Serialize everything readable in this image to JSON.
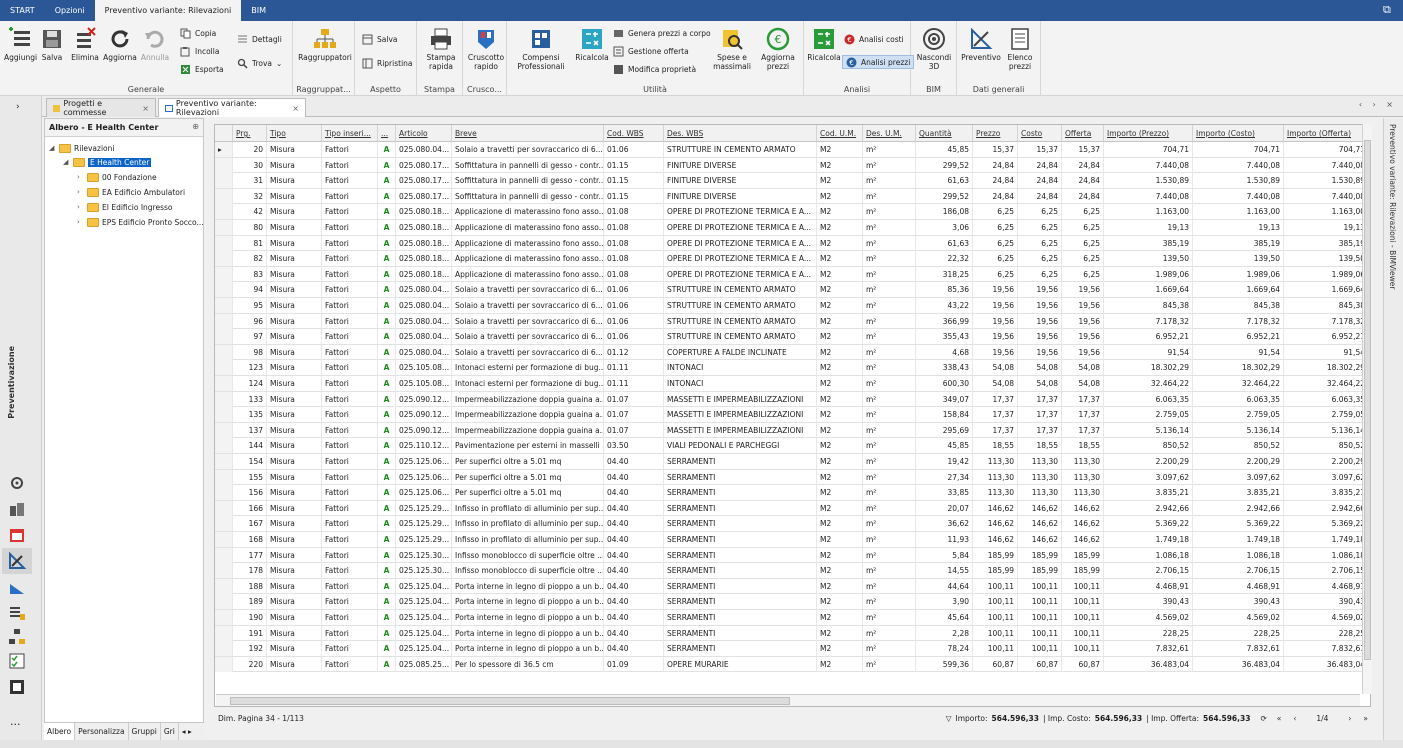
{
  "menu": {
    "tabs": [
      "START",
      "Opzioni",
      "Preventivo variante: Rilevazioni",
      "BIM"
    ],
    "active": 2
  },
  "ribbon": {
    "groups": [
      {
        "caption": "Generale",
        "buttons": [
          "Aggiungi",
          "Salva",
          "Elimina",
          "Aggiorna",
          "Annulla"
        ],
        "small": [
          "Copia",
          "Incolla",
          "Esporta",
          "Dettagli",
          "Trova"
        ]
      },
      {
        "caption": "Raggruppat...",
        "buttons": [
          "Raggruppatori"
        ]
      },
      {
        "caption": "Aspetto",
        "small": [
          "Salva",
          "Ripristina"
        ]
      },
      {
        "caption": "Stampa",
        "buttons": [
          "Stampa rapida"
        ]
      },
      {
        "caption": "Crusco...",
        "buttons": [
          "Cruscotto rapido"
        ]
      },
      {
        "caption": "Utilità",
        "buttons": [
          "Compensi Professionali",
          "Ricalcola"
        ],
        "small": [
          "Genera prezzi a corpo",
          "Gestione offerta",
          "Modifica proprietà"
        ],
        "buttons2": [
          "Spese e massimali",
          "Aggiorna prezzi"
        ]
      },
      {
        "caption": "Analisi",
        "buttons": [
          "Ricalcola"
        ],
        "small": [
          "Analisi costi",
          "Analisi prezzi"
        ]
      },
      {
        "caption": "BIM",
        "buttons": [
          "Nascondi 3D"
        ]
      },
      {
        "caption": "Dati generali",
        "buttons": [
          "Preventivo",
          "Elenco prezzi"
        ]
      }
    ]
  },
  "left_strip": {
    "label": "Preventivazione"
  },
  "doc_tabs": [
    "Progetti e commesse",
    "Preventivo variante: Rilevazioni"
  ],
  "tree": {
    "title": "Albero - E Health Center",
    "nodes": [
      "Rilevazioni",
      "E Health Center",
      "00 Fondazione",
      "EA Edificio Ambulatori",
      "EI Edificio Ingresso",
      "EPS Edificio Pronto Socco..."
    ],
    "tabs": [
      "Albero",
      "Personalizza",
      "Gruppi",
      "Gri"
    ]
  },
  "grid": {
    "columns": [
      "Prg.",
      "Tipo",
      "Tipo inseri...",
      "...",
      "Articolo",
      "Breve",
      "Cod. WBS",
      "Des. WBS",
      "Cod. U.M.",
      "Des. U.M.",
      "Quantità",
      "Prezzo",
      "Costo",
      "Offerta",
      "Importo (Prezzo)",
      "Importo (Costo)",
      "Importo (Offerta)"
    ],
    "rows": [
      [
        "20",
        "Misura",
        "Fattori",
        "A",
        "025.080.04...",
        "Solaio a travetti per sovraccarico di 6...",
        "01.06",
        "STRUTTURE IN CEMENTO ARMATO",
        "M2",
        "m²",
        "45,85",
        "15,37",
        "15,37",
        "15,37",
        "704,71",
        "704,71",
        "704,71"
      ],
      [
        "30",
        "Misura",
        "Fattori",
        "A",
        "025.080.17...",
        "Soffittatura in pannelli di gesso - contr...",
        "01.15",
        "FINITURE DIVERSE",
        "M2",
        "m²",
        "299,52",
        "24,84",
        "24,84",
        "24,84",
        "7.440,08",
        "7.440,08",
        "7.440,08"
      ],
      [
        "31",
        "Misura",
        "Fattori",
        "A",
        "025.080.17...",
        "Soffittatura in pannelli di gesso - contr...",
        "01.15",
        "FINITURE DIVERSE",
        "M2",
        "m²",
        "61,63",
        "24,84",
        "24,84",
        "24,84",
        "1.530,89",
        "1.530,89",
        "1.530,89"
      ],
      [
        "32",
        "Misura",
        "Fattori",
        "A",
        "025.080.17...",
        "Soffittatura in pannelli di gesso - contr...",
        "01.15",
        "FINITURE DIVERSE",
        "M2",
        "m²",
        "299,52",
        "24,84",
        "24,84",
        "24,84",
        "7.440,08",
        "7.440,08",
        "7.440,08"
      ],
      [
        "42",
        "Misura",
        "Fattori",
        "A",
        "025.080.18...",
        "Applicazione di materassino fono asso...",
        "01.08",
        "OPERE DI PROTEZIONE TERMICA E A...",
        "M2",
        "m²",
        "186,08",
        "6,25",
        "6,25",
        "6,25",
        "1.163,00",
        "1.163,00",
        "1.163,00"
      ],
      [
        "80",
        "Misura",
        "Fattori",
        "A",
        "025.080.18...",
        "Applicazione di materassino fono asso...",
        "01.08",
        "OPERE DI PROTEZIONE TERMICA E A...",
        "M2",
        "m²",
        "3,06",
        "6,25",
        "6,25",
        "6,25",
        "19,13",
        "19,13",
        "19,13"
      ],
      [
        "81",
        "Misura",
        "Fattori",
        "A",
        "025.080.18...",
        "Applicazione di materassino fono asso...",
        "01.08",
        "OPERE DI PROTEZIONE TERMICA E A...",
        "M2",
        "m²",
        "61,63",
        "6,25",
        "6,25",
        "6,25",
        "385,19",
        "385,19",
        "385,19"
      ],
      [
        "82",
        "Misura",
        "Fattori",
        "A",
        "025.080.18...",
        "Applicazione di materassino fono asso...",
        "01.08",
        "OPERE DI PROTEZIONE TERMICA E A...",
        "M2",
        "m²",
        "22,32",
        "6,25",
        "6,25",
        "6,25",
        "139,50",
        "139,50",
        "139,50"
      ],
      [
        "83",
        "Misura",
        "Fattori",
        "A",
        "025.080.18...",
        "Applicazione di materassino fono asso...",
        "01.08",
        "OPERE DI PROTEZIONE TERMICA E A...",
        "M2",
        "m²",
        "318,25",
        "6,25",
        "6,25",
        "6,25",
        "1.989,06",
        "1.989,06",
        "1.989,06"
      ],
      [
        "94",
        "Misura",
        "Fattori",
        "A",
        "025.080.04...",
        "Solaio a travetti per sovraccarico di 6...",
        "01.06",
        "STRUTTURE IN CEMENTO ARMATO",
        "M2",
        "m²",
        "85,36",
        "19,56",
        "19,56",
        "19,56",
        "1.669,64",
        "1.669,64",
        "1.669,64"
      ],
      [
        "95",
        "Misura",
        "Fattori",
        "A",
        "025.080.04...",
        "Solaio a travetti per sovraccarico di 6...",
        "01.06",
        "STRUTTURE IN CEMENTO ARMATO",
        "M2",
        "m²",
        "43,22",
        "19,56",
        "19,56",
        "19,56",
        "845,38",
        "845,38",
        "845,38"
      ],
      [
        "96",
        "Misura",
        "Fattori",
        "A",
        "025.080.04...",
        "Solaio a travetti per sovraccarico di 6...",
        "01.06",
        "STRUTTURE IN CEMENTO ARMATO",
        "M2",
        "m²",
        "366,99",
        "19,56",
        "19,56",
        "19,56",
        "7.178,32",
        "7.178,32",
        "7.178,32"
      ],
      [
        "97",
        "Misura",
        "Fattori",
        "A",
        "025.080.04...",
        "Solaio a travetti per sovraccarico di 6...",
        "01.06",
        "STRUTTURE IN CEMENTO ARMATO",
        "M2",
        "m²",
        "355,43",
        "19,56",
        "19,56",
        "19,56",
        "6.952,21",
        "6.952,21",
        "6.952,21"
      ],
      [
        "98",
        "Misura",
        "Fattori",
        "A",
        "025.080.04...",
        "Solaio a travetti per sovraccarico di 6...",
        "01.12",
        "COPERTURE A FALDE INCLINATE",
        "M2",
        "m²",
        "4,68",
        "19,56",
        "19,56",
        "19,56",
        "91,54",
        "91,54",
        "91,54"
      ],
      [
        "123",
        "Misura",
        "Fattori",
        "A",
        "025.105.08...",
        "Intonaci esterni per formazione di bug...",
        "01.11",
        "INTONACI",
        "M2",
        "m²",
        "338,43",
        "54,08",
        "54,08",
        "54,08",
        "18.302,29",
        "18.302,29",
        "18.302,29"
      ],
      [
        "124",
        "Misura",
        "Fattori",
        "A",
        "025.105.08...",
        "Intonaci esterni per formazione di bug...",
        "01.11",
        "INTONACI",
        "M2",
        "m²",
        "600,30",
        "54,08",
        "54,08",
        "54,08",
        "32.464,22",
        "32.464,22",
        "32.464,22"
      ],
      [
        "133",
        "Misura",
        "Fattori",
        "A",
        "025.090.12...",
        "Impermeabilizzazione doppia guaina a...",
        "01.07",
        "MASSETTI E IMPERMEABILIZZAZIONI",
        "M2",
        "m²",
        "349,07",
        "17,37",
        "17,37",
        "17,37",
        "6.063,35",
        "6.063,35",
        "6.063,35"
      ],
      [
        "135",
        "Misura",
        "Fattori",
        "A",
        "025.090.12...",
        "Impermeabilizzazione doppia guaina a...",
        "01.07",
        "MASSETTI E IMPERMEABILIZZAZIONI",
        "M2",
        "m²",
        "158,84",
        "17,37",
        "17,37",
        "17,37",
        "2.759,05",
        "2.759,05",
        "2.759,05"
      ],
      [
        "137",
        "Misura",
        "Fattori",
        "A",
        "025.090.12...",
        "Impermeabilizzazione doppia guaina a...",
        "01.07",
        "MASSETTI E IMPERMEABILIZZAZIONI",
        "M2",
        "m²",
        "295,69",
        "17,37",
        "17,37",
        "17,37",
        "5.136,14",
        "5.136,14",
        "5.136,14"
      ],
      [
        "144",
        "Misura",
        "Fattori",
        "A",
        "025.110.12...",
        "Pavimentazione per esterni in masselli ...",
        "03.50",
        "VIALI PEDONALI E PARCHEGGI",
        "M2",
        "m²",
        "45,85",
        "18,55",
        "18,55",
        "18,55",
        "850,52",
        "850,52",
        "850,52"
      ],
      [
        "154",
        "Misura",
        "Fattori",
        "A",
        "025.125.06...",
        "Per superfici oltre a 5.01 mq",
        "04.40",
        "SERRAMENTI",
        "M2",
        "m²",
        "19,42",
        "113,30",
        "113,30",
        "113,30",
        "2.200,29",
        "2.200,29",
        "2.200,29"
      ],
      [
        "155",
        "Misura",
        "Fattori",
        "A",
        "025.125.06...",
        "Per superfici oltre a 5.01 mq",
        "04.40",
        "SERRAMENTI",
        "M2",
        "m²",
        "27,34",
        "113,30",
        "113,30",
        "113,30",
        "3.097,62",
        "3.097,62",
        "3.097,62"
      ],
      [
        "156",
        "Misura",
        "Fattori",
        "A",
        "025.125.06...",
        "Per superfici oltre a 5.01 mq",
        "04.40",
        "SERRAMENTI",
        "M2",
        "m²",
        "33,85",
        "113,30",
        "113,30",
        "113,30",
        "3.835,21",
        "3.835,21",
        "3.835,21"
      ],
      [
        "166",
        "Misura",
        "Fattori",
        "A",
        "025.125.29...",
        "Infisso in profilato di alluminio per sup...",
        "04.40",
        "SERRAMENTI",
        "M2",
        "m²",
        "20,07",
        "146,62",
        "146,62",
        "146,62",
        "2.942,66",
        "2.942,66",
        "2.942,66"
      ],
      [
        "167",
        "Misura",
        "Fattori",
        "A",
        "025.125.29...",
        "Infisso in profilato di alluminio per sup...",
        "04.40",
        "SERRAMENTI",
        "M2",
        "m²",
        "36,62",
        "146,62",
        "146,62",
        "146,62",
        "5.369,22",
        "5.369,22",
        "5.369,22"
      ],
      [
        "168",
        "Misura",
        "Fattori",
        "A",
        "025.125.29...",
        "Infisso in profilato di alluminio per sup...",
        "04.40",
        "SERRAMENTI",
        "M2",
        "m²",
        "11,93",
        "146,62",
        "146,62",
        "146,62",
        "1.749,18",
        "1.749,18",
        "1.749,18"
      ],
      [
        "177",
        "Misura",
        "Fattori",
        "A",
        "025.125.30...",
        "Infisso monoblocco di  superficie oltre ...",
        "04.40",
        "SERRAMENTI",
        "M2",
        "m²",
        "5,84",
        "185,99",
        "185,99",
        "185,99",
        "1.086,18",
        "1.086,18",
        "1.086,18"
      ],
      [
        "178",
        "Misura",
        "Fattori",
        "A",
        "025.125.30...",
        "Infisso monoblocco di  superficie oltre ...",
        "04.40",
        "SERRAMENTI",
        "M2",
        "m²",
        "14,55",
        "185,99",
        "185,99",
        "185,99",
        "2.706,15",
        "2.706,15",
        "2.706,15"
      ],
      [
        "188",
        "Misura",
        "Fattori",
        "A",
        "025.125.04...",
        "Porta interne in legno di pioppo a un b...",
        "04.40",
        "SERRAMENTI",
        "M2",
        "m²",
        "44,64",
        "100,11",
        "100,11",
        "100,11",
        "4.468,91",
        "4.468,91",
        "4.468,91"
      ],
      [
        "189",
        "Misura",
        "Fattori",
        "A",
        "025.125.04...",
        "Porta interne in legno di pioppo a un b...",
        "04.40",
        "SERRAMENTI",
        "M2",
        "m²",
        "3,90",
        "100,11",
        "100,11",
        "100,11",
        "390,43",
        "390,43",
        "390,43"
      ],
      [
        "190",
        "Misura",
        "Fattori",
        "A",
        "025.125.04...",
        "Porta interne in legno di pioppo a un b...",
        "04.40",
        "SERRAMENTI",
        "M2",
        "m²",
        "45,64",
        "100,11",
        "100,11",
        "100,11",
        "4.569,02",
        "4.569,02",
        "4.569,02"
      ],
      [
        "191",
        "Misura",
        "Fattori",
        "A",
        "025.125.04...",
        "Porta interne in legno di pioppo a un b...",
        "04.40",
        "SERRAMENTI",
        "M2",
        "m²",
        "2,28",
        "100,11",
        "100,11",
        "100,11",
        "228,25",
        "228,25",
        "228,25"
      ],
      [
        "192",
        "Misura",
        "Fattori",
        "A",
        "025.125.04...",
        "Porta interne in legno di pioppo a un b...",
        "04.40",
        "SERRAMENTI",
        "M2",
        "m²",
        "78,24",
        "100,11",
        "100,11",
        "100,11",
        "7.832,61",
        "7.832,61",
        "7.832,61"
      ],
      [
        "220",
        "Misura",
        "Fattori",
        "A",
        "025.085.25...",
        "Per lo spessore di 36.5 cm",
        "01.09",
        "OPERE MURARIE",
        "M2",
        "m²",
        "599,36",
        "60,87",
        "60,87",
        "60,87",
        "36.483,04",
        "36.483,04",
        "36.483,04"
      ]
    ]
  },
  "status": {
    "page": "Dim. Pagina 34 - 1/113",
    "importo_label": "Importo:",
    "importo": "564.596,33",
    "costo_label": "| Imp. Costo:",
    "costo": "564.596,33",
    "offerta_label": "| Imp. Offerta:",
    "offerta": "564.596,33",
    "pager": "1/4"
  },
  "right_panel": {
    "label": "Preventivo variante: Rilevazioni - BIMViewer"
  },
  "colors": {
    "menubar": "#2b5797",
    "selection": "#0c64c8",
    "accent_green": "#1a8a1a"
  }
}
